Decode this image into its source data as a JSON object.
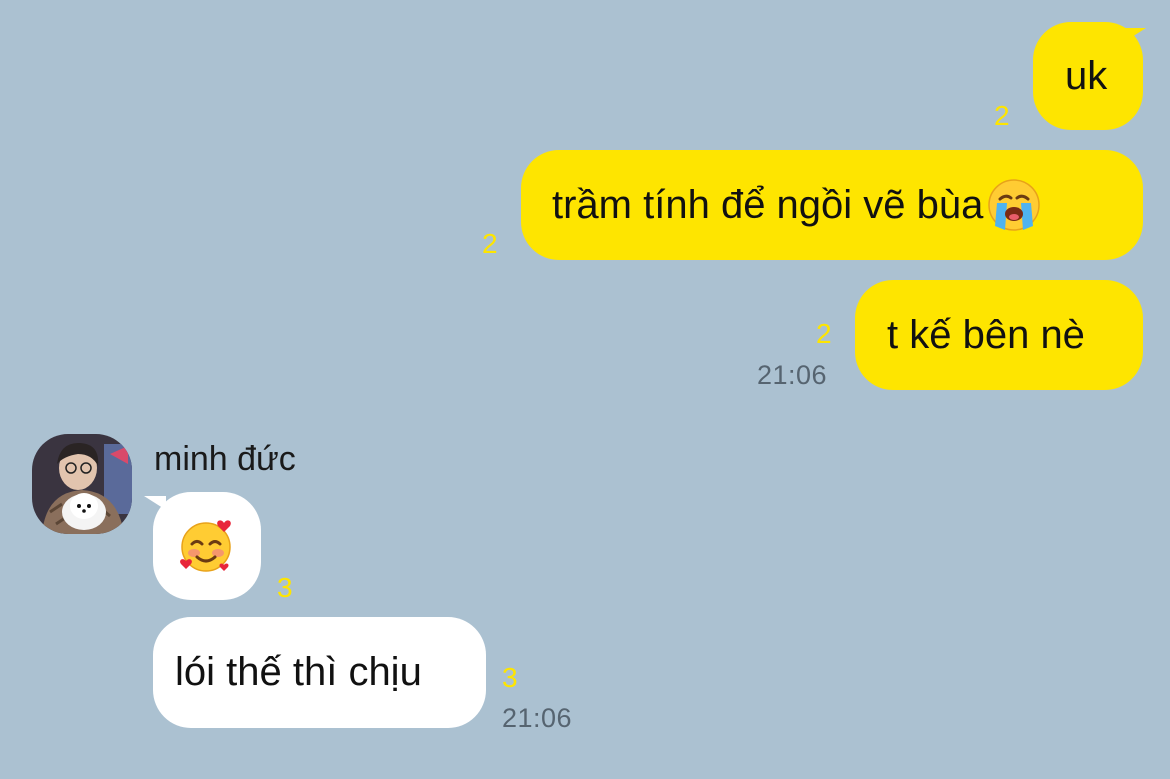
{
  "theme": {
    "background": "#abc1d1",
    "sent_bubble": "#fee500",
    "received_bubble": "#ffffff",
    "unread_count_color": "#fee500",
    "timestamp_color": "#566470"
  },
  "messages_sent": [
    {
      "text": "uk",
      "unread": "2"
    },
    {
      "text": "trầm tính để ngồi vẽ bùa",
      "emoji": "loudly-crying-face-emoji",
      "unread": "2"
    },
    {
      "text": "t kế bên nè",
      "unread": "2",
      "time": "21:06"
    }
  ],
  "received_group": {
    "sender_name": "minh đức",
    "avatar": "avatar-person-holding-white-dog",
    "messages": [
      {
        "emoji": "smiling-face-with-hearts-emoji",
        "unread": "3"
      },
      {
        "text": "lói thế thì chịu",
        "unread": "3",
        "time": "21:06"
      }
    ]
  }
}
